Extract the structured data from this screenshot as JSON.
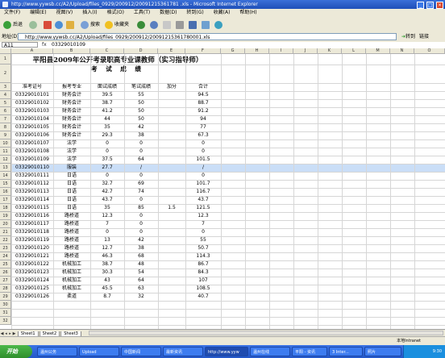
{
  "window": {
    "title": "http://www.yywsb.cc/A2/Upload/files_0929/200912/20091215361781 .xls - Microsoft Internet Explorer",
    "min": "_",
    "max": "□",
    "close": "×"
  },
  "menu": [
    "文件(F)",
    "编辑(E)",
    "视图(V)",
    "插入(I)",
    "格式(O)",
    "工具(T)",
    "数据(D)",
    "转到(G)",
    "收藏(A)",
    "帮助(H)"
  ],
  "toolbar": {
    "back": "后退",
    "search": "搜索",
    "favorites": "收藏夹"
  },
  "address": {
    "label": "地址(D)",
    "url": "http://www.yywsb.cc/A2/Upload/files_0929/200912/20091215361780001.xls",
    "go": "转到",
    "links": "链接"
  },
  "formula": {
    "namebox": "A11",
    "fx": "fx",
    "value": "03329010109"
  },
  "columns": [
    "A",
    "B",
    "C",
    "D",
    "E",
    "F",
    "G",
    "H",
    "I",
    "J",
    "K",
    "L",
    "M",
    "N",
    "O"
  ],
  "title": "平阳县2009年公开考录职高专业课教师（实习指导师）",
  "subtitle": "考 试 成 绩",
  "headers": [
    "准考证号",
    "报考专业",
    "面试成绩",
    "笔试成绩",
    "加分",
    "合计"
  ],
  "rows": [
    [
      "03329010101",
      "财务会计",
      "39.5",
      "55",
      "",
      "94.5"
    ],
    [
      "03329010102",
      "财务会计",
      "38.7",
      "50",
      "",
      "88.7"
    ],
    [
      "03329010103",
      "财务会计",
      "41.2",
      "50",
      "",
      "91.2"
    ],
    [
      "03329010104",
      "财务会计",
      "44",
      "50",
      "",
      "94"
    ],
    [
      "03329010105",
      "财务会计",
      "35",
      "42",
      "",
      "77"
    ],
    [
      "03329010106",
      "财务会计",
      "29.3",
      "38",
      "",
      "67.3"
    ],
    [
      "03329010107",
      "法学",
      "0",
      "0",
      "",
      "0"
    ],
    [
      "03329010108",
      "法学",
      "0",
      "0",
      "",
      "0"
    ],
    [
      "03329010109",
      "法学",
      "37.5",
      "64",
      "",
      "101.5"
    ],
    [
      "03329010110",
      "服装",
      "27.7",
      "/",
      "",
      "/"
    ],
    [
      "03329010111",
      "日语",
      "0",
      "0",
      "",
      "0"
    ],
    [
      "03329010112",
      "日语",
      "32.7",
      "69",
      "",
      "101.7"
    ],
    [
      "03329010113",
      "日语",
      "42.7",
      "74",
      "",
      "116.7"
    ],
    [
      "03329010114",
      "日语",
      "43.7",
      "0",
      "",
      "43.7"
    ],
    [
      "03329010115",
      "日语",
      "35",
      "85",
      "1.5",
      "121.5"
    ],
    [
      "03329010116",
      "路桥道",
      "12.3",
      "0",
      "",
      "12.3"
    ],
    [
      "03329010117",
      "路桥道",
      "7",
      "0",
      "",
      "7"
    ],
    [
      "03329010118",
      "路桥道",
      "0",
      "0",
      "",
      "0"
    ],
    [
      "03329010119",
      "路桥道",
      "13",
      "42",
      "",
      "55"
    ],
    [
      "03329010120",
      "路桥道",
      "12.7",
      "38",
      "",
      "50.7"
    ],
    [
      "03329010121",
      "路桥道",
      "46.3",
      "68",
      "",
      "114.3"
    ],
    [
      "03329010122",
      "机械加工",
      "38.7",
      "48",
      "",
      "86.7"
    ],
    [
      "03329010123",
      "机械加工",
      "30.3",
      "54",
      "",
      "84.3"
    ],
    [
      "03329010124",
      "机械加工",
      "43",
      "64",
      "",
      "107"
    ],
    [
      "03329010125",
      "机械加工",
      "45.5",
      "63",
      "",
      "108.5"
    ],
    [
      "03329010126",
      "柔道",
      "8.7",
      "32",
      "",
      "40.7"
    ]
  ],
  "sheets": [
    "Sheet1",
    "Sheet2",
    "Sheet3"
  ],
  "status": {
    "zone": "本地Intranet"
  },
  "taskbar": {
    "start": "开始",
    "tasks": [
      "温州公务",
      "Upload",
      "中国新闻",
      "最新资讯",
      "http://www.yyw",
      "温州在线",
      "平阳 - 资讯",
      "3 Inter...",
      "照片"
    ],
    "clock": "9:30"
  }
}
